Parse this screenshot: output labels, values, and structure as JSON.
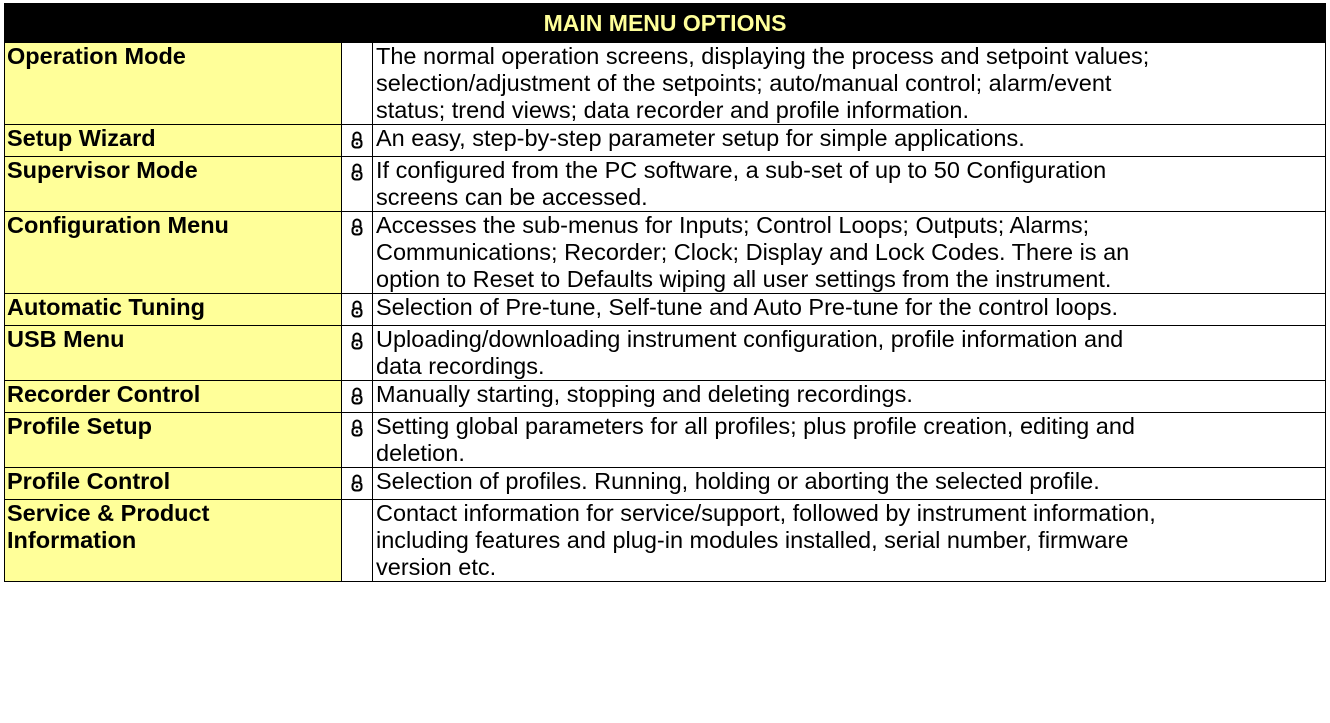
{
  "header": {
    "title": "MAIN MENU OPTIONS"
  },
  "rows": [
    {
      "name": "Operation Mode",
      "locked": false,
      "lines": [
        "The normal operation screens, displaying the process and setpoint values;",
        "selection/adjustment of the setpoints; auto/manual control; alarm/event",
        "status; trend views; data recorder and profile information."
      ]
    },
    {
      "name": "Setup Wizard",
      "locked": true,
      "lines": [
        "An easy, step-by-step parameter setup for simple applications."
      ]
    },
    {
      "name": "Supervisor Mode",
      "locked": true,
      "lines": [
        "If configured from the PC software, a sub-set of up to 50 Configuration",
        "screens can be accessed."
      ]
    },
    {
      "name": "Configuration Menu",
      "locked": true,
      "lines": [
        "Accesses the sub-menus for Inputs; Control Loops; Outputs; Alarms;",
        "Communications; Recorder; Clock; Display and Lock Codes. There is an",
        "option to Reset to Defaults wiping all user settings from the instrument."
      ]
    },
    {
      "name": "Automatic Tuning",
      "locked": true,
      "lines": [
        "Selection of Pre-tune, Self-tune and Auto Pre-tune for the control loops."
      ]
    },
    {
      "name": "USB Menu",
      "locked": true,
      "lines": [
        "Uploading/downloading instrument configuration, profile information and",
        "data recordings."
      ]
    },
    {
      "name": "Recorder Control",
      "locked": true,
      "lines": [
        "Manually starting, stopping and deleting recordings."
      ]
    },
    {
      "name": "Profile Setup",
      "locked": true,
      "lines": [
        "Setting global parameters for all profiles; plus profile creation, editing and",
        "deletion."
      ]
    },
    {
      "name": "Profile Control",
      "locked": true,
      "lines": [
        "Selection of profiles. Running, holding or aborting the selected profile."
      ]
    },
    {
      "name": "Service & Product Information",
      "name_lines": [
        "Service & Product",
        "Information"
      ],
      "locked": false,
      "lines": [
        "Contact information for service/support, followed by instrument information,",
        "including features and plug-in modules installed, serial number, firmware",
        "version etc."
      ]
    }
  ]
}
